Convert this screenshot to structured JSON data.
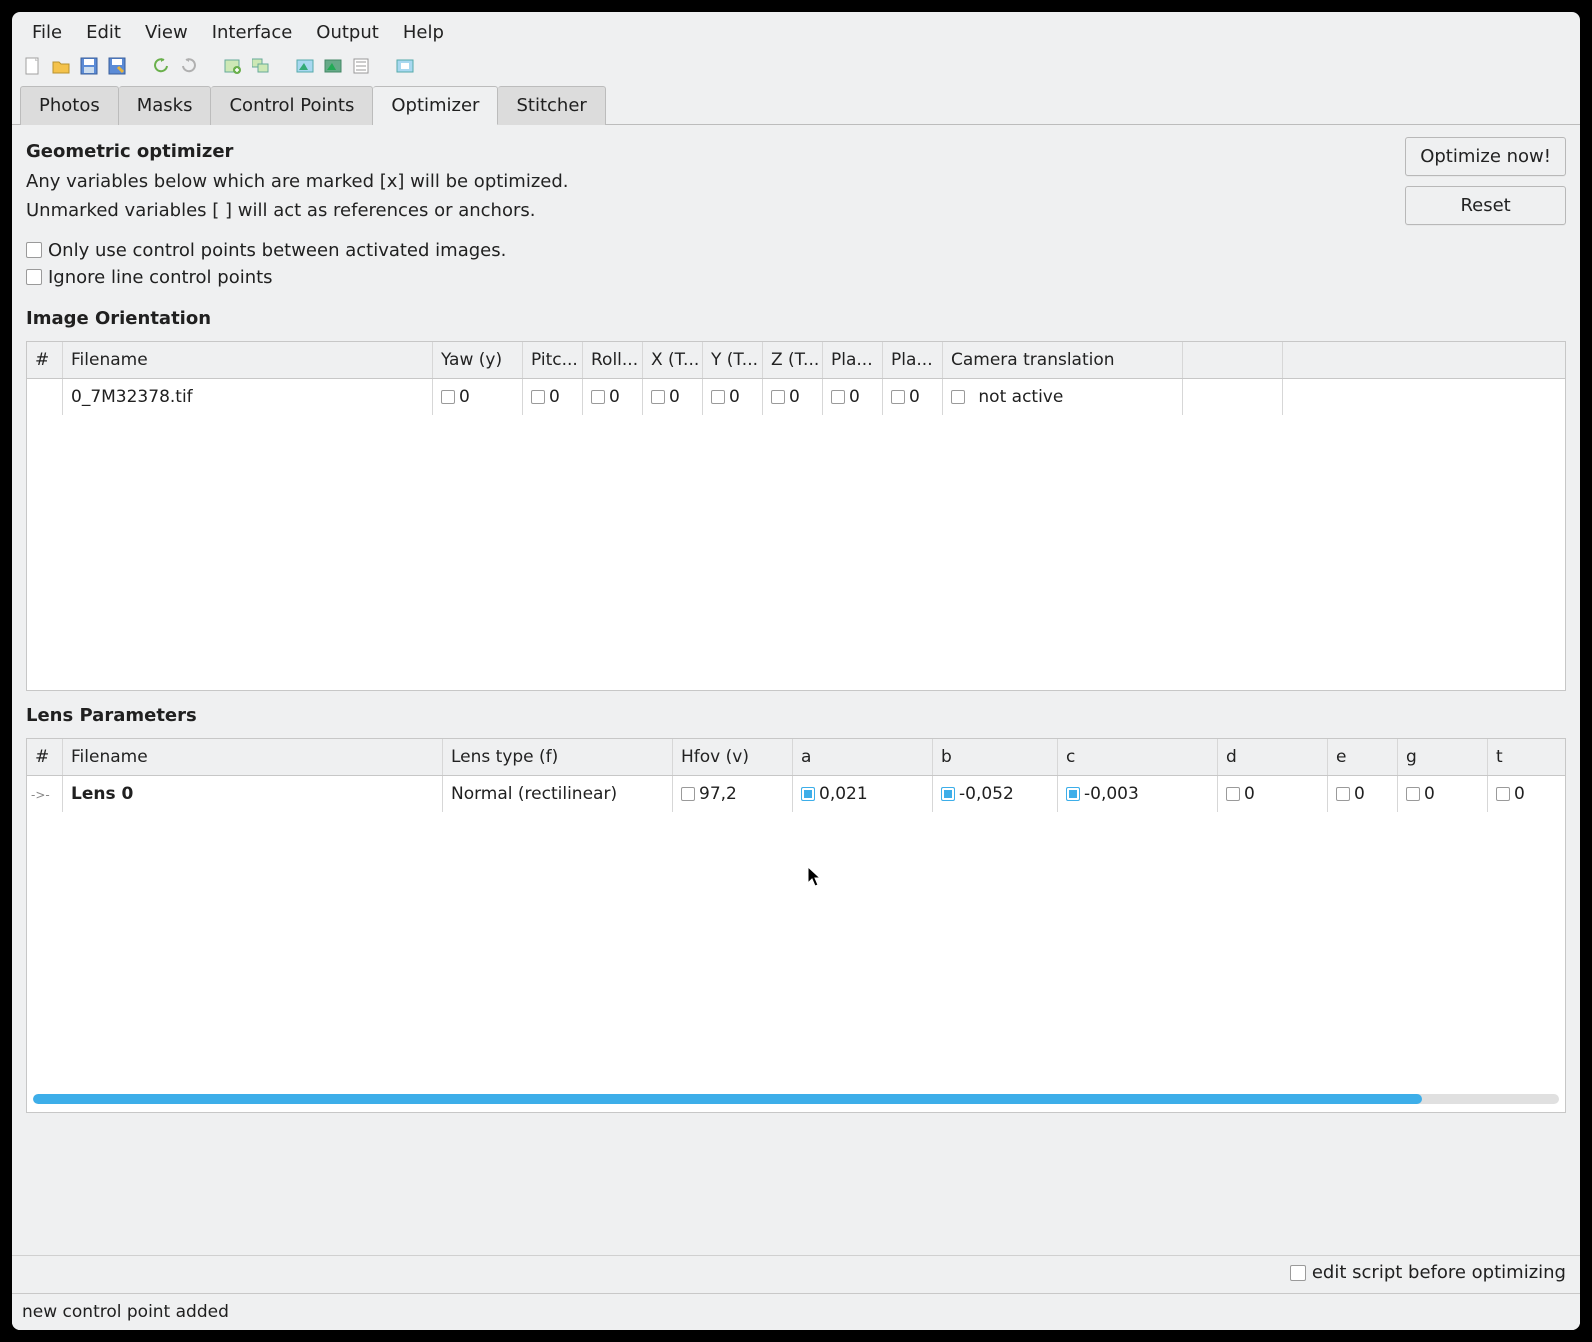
{
  "menu": {
    "file": "File",
    "edit": "Edit",
    "view": "View",
    "interface": "Interface",
    "output": "Output",
    "help": "Help"
  },
  "tabs": {
    "photos": "Photos",
    "masks": "Masks",
    "cp": "Control Points",
    "opt": "Optimizer",
    "stitcher": "Stitcher"
  },
  "optimizer": {
    "title": "Geometric optimizer",
    "desc1": "Any variables below which are marked [x] will be optimized.",
    "desc2": "Unmarked variables [ ] will act as references or anchors.",
    "chk_only": "Only use control points between activated images.",
    "chk_ignore": "Ignore line control points",
    "optimize_btn": "Optimize now!",
    "reset_btn": "Reset"
  },
  "orient": {
    "title": "Image Orientation",
    "headers": {
      "num": "#",
      "fn": "Filename",
      "yaw": "Yaw (y)",
      "pitch": "Pitc...",
      "roll": "Roll...",
      "x": "X (T...",
      "y": "Y (T...",
      "z": "Z (T...",
      "pla1": "Pla...",
      "pla2": "Pla...",
      "cam": "Camera translation"
    },
    "rows": [
      {
        "fn": "0_7M32378.tif",
        "yaw": "0",
        "pitch": "0",
        "roll": "0",
        "x": "0",
        "y": "0",
        "z": "0",
        "pla1": "0",
        "pla2": "0",
        "cam": "not active"
      }
    ]
  },
  "lens": {
    "title": "Lens Parameters",
    "headers": {
      "num": "#",
      "fn": "Filename",
      "type": "Lens type (f)",
      "hfov": "Hfov (v)",
      "a": "a",
      "b": "b",
      "c": "c",
      "d": "d",
      "e": "e",
      "g": "g",
      "t": "t"
    },
    "rows": [
      {
        "fn": "Lens 0",
        "type": "Normal (rectilinear)",
        "hfov": "97,2",
        "a": "0,021",
        "b": "-0,052",
        "c": "-0,003",
        "d": "0",
        "e": "0",
        "g": "0",
        "t": "0",
        "checked": {
          "hfov": false,
          "a": true,
          "b": true,
          "c": true,
          "d": false,
          "e": false,
          "g": false,
          "t": false
        }
      }
    ]
  },
  "footer": {
    "edit": "edit script before optimizing"
  },
  "status": "new control point added"
}
